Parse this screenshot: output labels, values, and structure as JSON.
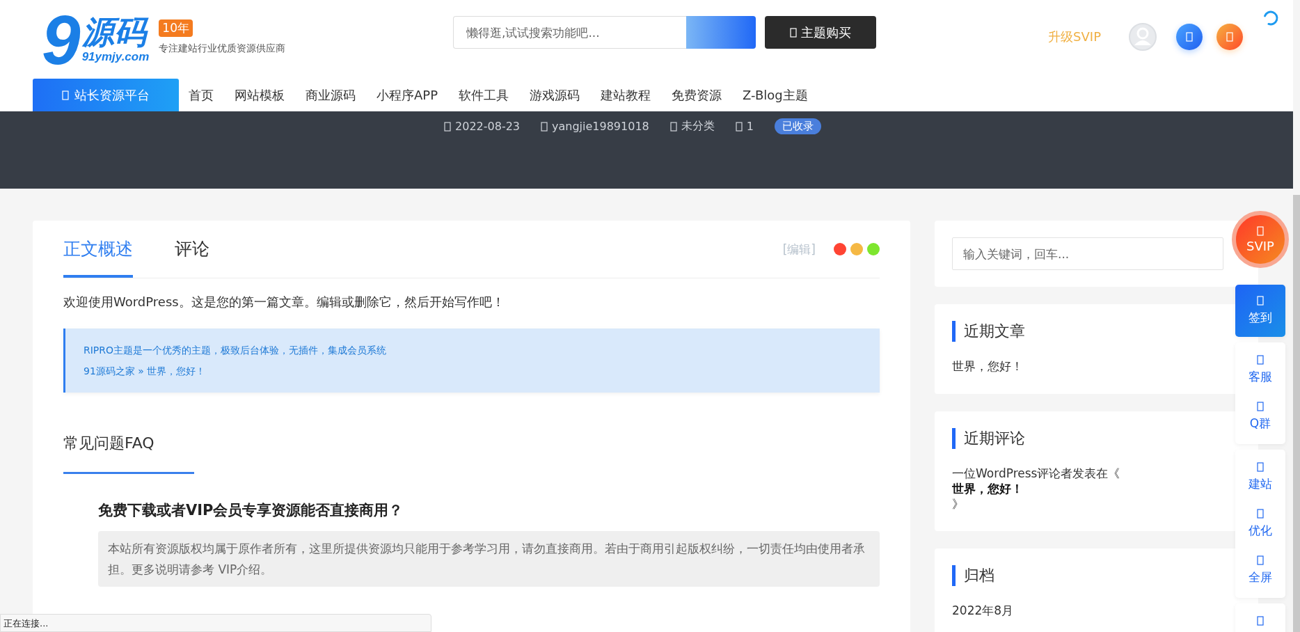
{
  "header": {
    "logo": {
      "mark": "9",
      "name": "源码",
      "domain": "91ymjy.com",
      "badge": "10年",
      "slogan": "专注建站行业优质资源供应商"
    },
    "search": {
      "placeholder": "懒得逛,试试搜索功能吧..."
    },
    "buy_button": "主题购买",
    "upgrade_link": "升级SVIP"
  },
  "nav": {
    "platform_button": "站长资源平台",
    "items": [
      "首页",
      "网站模板",
      "商业源码",
      "小程序APP",
      "软件工具",
      "游戏源码",
      "建站教程",
      "免费资源",
      "Z-Blog主题"
    ]
  },
  "meta": {
    "date": "2022-08-23",
    "author": "yangjie19891018",
    "category": "未分类",
    "comments": "1",
    "badge": "已收录"
  },
  "article": {
    "tabs": [
      {
        "label": "正文概述",
        "selected": true
      },
      {
        "label": "评论",
        "selected": false
      }
    ],
    "edit_link": "[编辑]",
    "dots": [
      {
        "color": "#ff4433"
      },
      {
        "color": "#f5b844"
      },
      {
        "color": "#7ee62e"
      }
    ],
    "intro": "欢迎使用WordPress。这是您的第一篇文章。编辑或删除它，然后开始写作吧！",
    "notice": [
      "RIPRO主题是一个优秀的主题，极致后台体验，无插件，集成会员系统",
      "91源码之家 » 世界，您好！"
    ],
    "faq_title": "常见问题FAQ",
    "faq": [
      {
        "question": "免费下载或者VIP会员专享资源能否直接商用？",
        "answer": "本站所有资源版权均属于原作者所有，这里所提供资源均只能用于参考学习用，请勿直接商用。若由于商用引起版权纠纷，一切责任均由使用者承担。更多说明请参考 VIP介绍。"
      }
    ]
  },
  "sidebar": {
    "search": {
      "placeholder": "输入关键词，回车..."
    },
    "widgets": [
      {
        "kind": "list",
        "title": "近期文章",
        "items": [
          "世界，您好！"
        ]
      },
      {
        "kind": "comment",
        "title": "近期评论",
        "prefix": "一位WordPress评论者发表在《",
        "post": "世界，您好！",
        "suffix": "》"
      },
      {
        "kind": "list",
        "title": "归档",
        "items": [
          "2022年8月"
        ]
      }
    ]
  },
  "float_toolbar": {
    "svip": "SVIP",
    "groups": [
      {
        "kind": "primary",
        "items": [
          "签到"
        ]
      },
      {
        "kind": "plain",
        "items": [
          "客服",
          "Q群"
        ]
      },
      {
        "kind": "plain",
        "items": [
          "建站",
          "优化",
          "全屏"
        ]
      },
      {
        "kind": "icon"
      }
    ]
  },
  "status_bar": "正在连接..."
}
